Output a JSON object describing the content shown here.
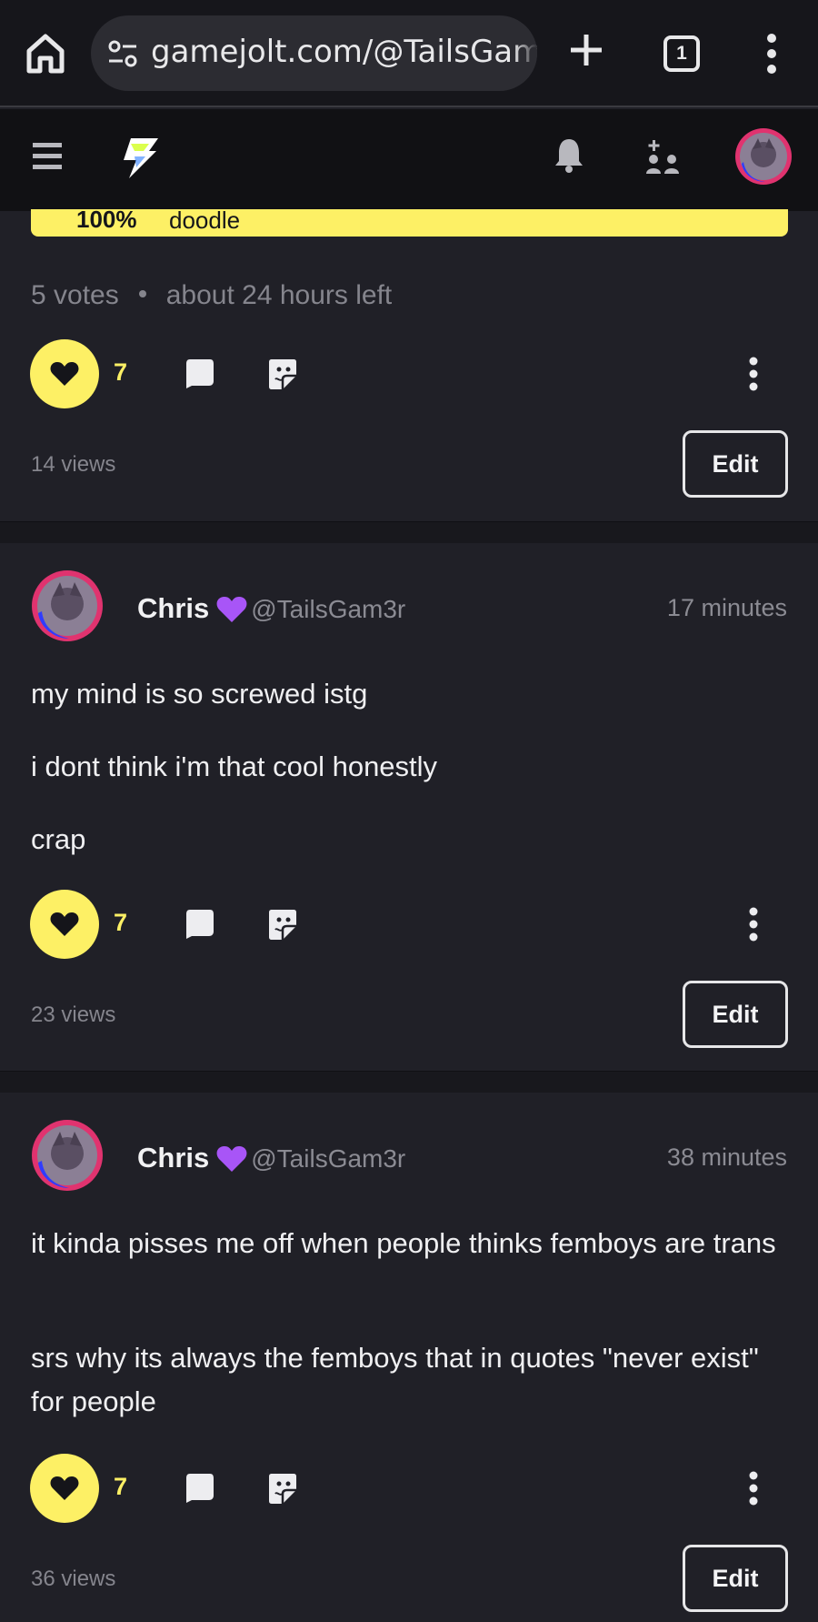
{
  "browser": {
    "url": "gamejolt.com/@TailsGam3r",
    "tab_count": "1"
  },
  "poll": {
    "percent": "100%",
    "option": "doodle",
    "votes": "5 votes",
    "time_left": "about 24 hours left",
    "likes": "7",
    "views": "14 views",
    "edit_label": "Edit"
  },
  "posts": [
    {
      "author": "Chris",
      "handle": "@TailsGam3r",
      "time": "17 minutes",
      "paragraphs": [
        "my mind is so screwed istg",
        "i dont think i'm that cool honestly",
        "crap"
      ],
      "likes": "7",
      "views": "23 views",
      "edit_label": "Edit"
    },
    {
      "author": "Chris",
      "handle": "@TailsGam3r",
      "time": "38 minutes",
      "paragraphs": [
        "it kinda pisses me off when people thinks femboys are trans",
        "srs why its always the femboys that in quotes \"never exist\" for people"
      ],
      "likes": "7",
      "views": "36 views",
      "edit_label": "Edit"
    }
  ],
  "colors": {
    "accent_yellow": "#fdf065",
    "background": "#202027",
    "header": "#111114",
    "muted_text": "#85858d",
    "heart_purple": "#a855f7"
  },
  "icons": [
    "home-icon",
    "site-settings-icon",
    "new-tab-icon",
    "tab-switcher-icon",
    "browser-menu-icon",
    "hamburger-icon",
    "gamejolt-logo-icon",
    "bell-icon",
    "friends-icon",
    "heart-icon",
    "comment-icon",
    "sticker-icon",
    "more-vertical-icon",
    "purple-heart-icon"
  ]
}
